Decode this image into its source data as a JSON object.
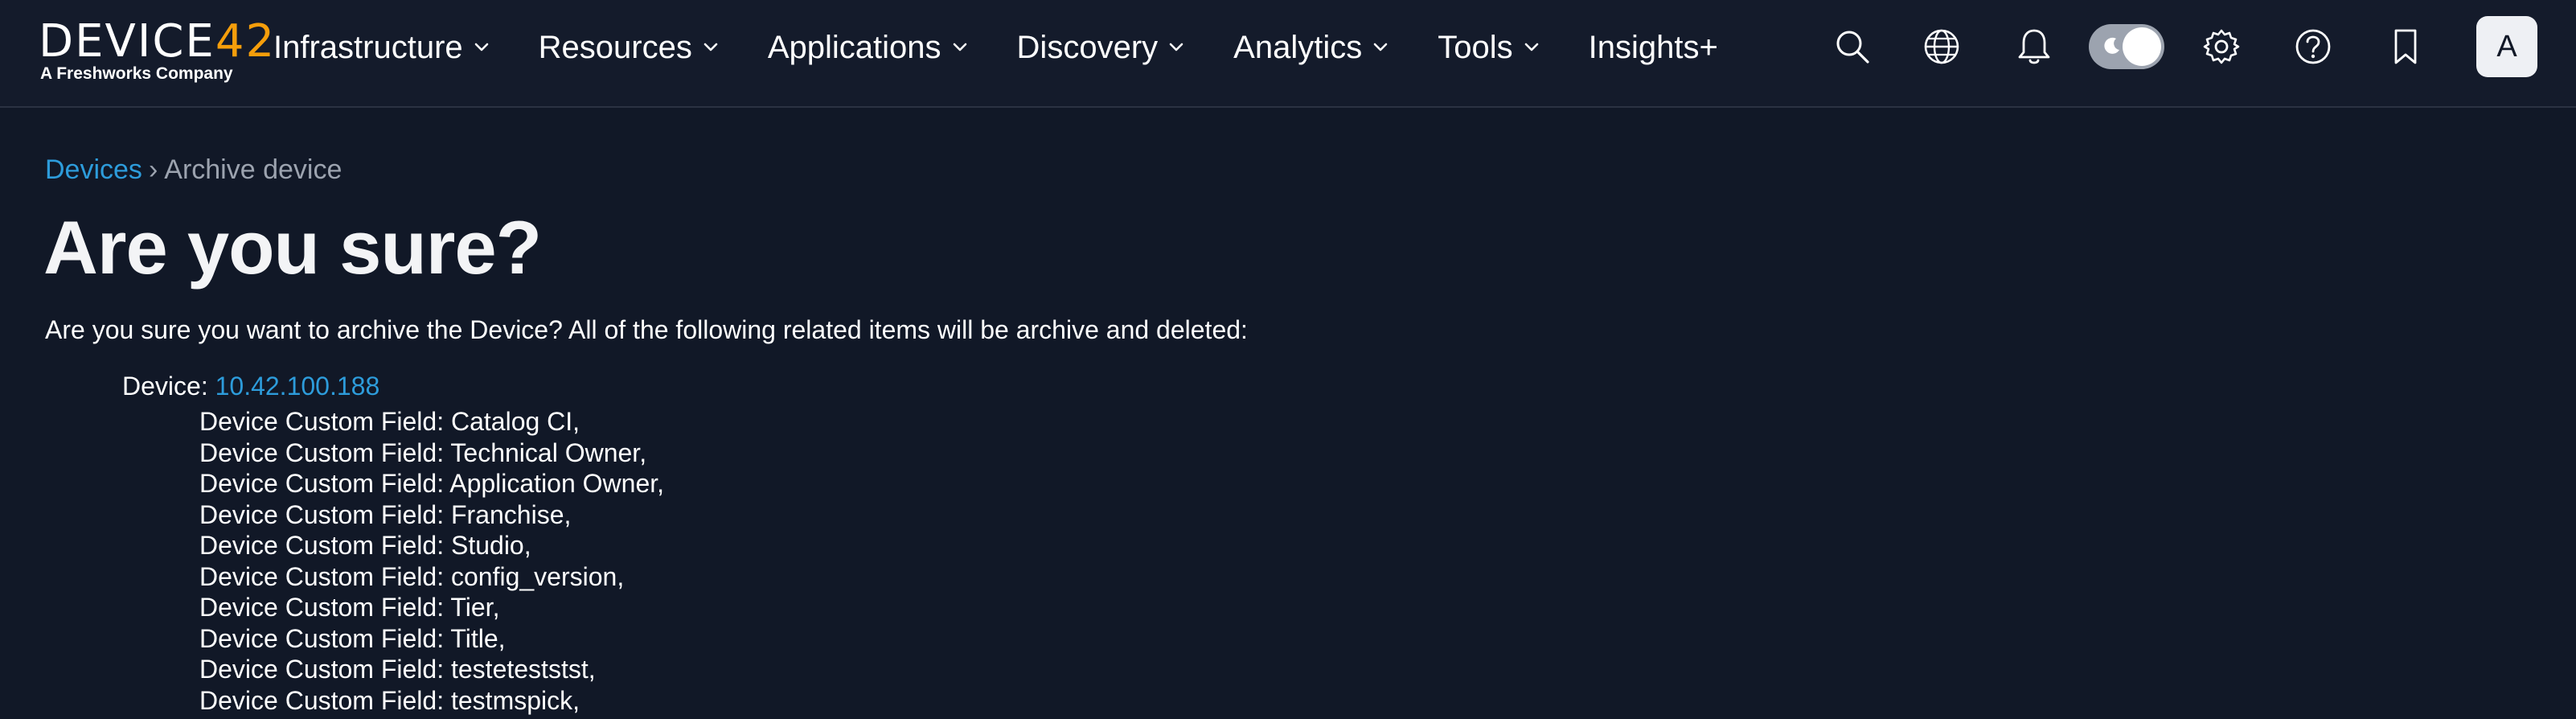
{
  "brand": {
    "logo_prefix": "DEVICE",
    "logo_number": "42",
    "logo_tagline": "A Freshworks Company",
    "accent_color": "#f59e0b",
    "link_color": "#2d9cdb"
  },
  "nav": {
    "items": [
      {
        "label": "Infrastructure",
        "has_dropdown": true
      },
      {
        "label": "Resources",
        "has_dropdown": true
      },
      {
        "label": "Applications",
        "has_dropdown": true
      },
      {
        "label": "Discovery",
        "has_dropdown": true
      },
      {
        "label": "Analytics",
        "has_dropdown": true
      },
      {
        "label": "Tools",
        "has_dropdown": true
      },
      {
        "label": "Insights+",
        "has_dropdown": false
      }
    ]
  },
  "toolbar": {
    "icons": [
      "search-icon",
      "globe-icon",
      "bell-icon",
      "theme-toggle",
      "gear-icon",
      "help-icon",
      "bookmark-icon"
    ],
    "avatar_initial": "A"
  },
  "breadcrumb": {
    "parent": "Devices",
    "separator": "›",
    "current": "Archive device"
  },
  "page": {
    "title": "Are you sure?",
    "intro": "Are you sure you want to archive the Device? All of the following related items will be archive and deleted:",
    "device_label": "Device:",
    "device_link": "10.42.100.188",
    "related_items": [
      "Device Custom Field: Catalog CI,",
      "Device Custom Field: Technical Owner,",
      "Device Custom Field: Application Owner,",
      "Device Custom Field: Franchise,",
      "Device Custom Field: Studio,",
      "Device Custom Field: config_version,",
      "Device Custom Field: Tier,",
      "Device Custom Field: Title,",
      "Device Custom Field: testeteststst,",
      "Device Custom Field: testmspick,"
    ]
  }
}
